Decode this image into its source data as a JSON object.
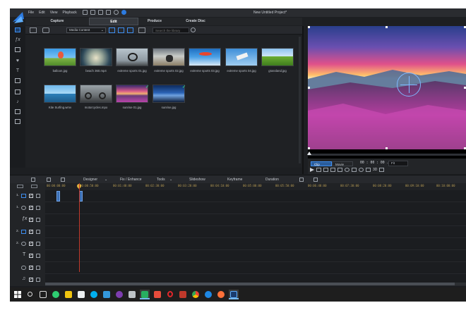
{
  "title_bar": {
    "menu": [
      "File",
      "Edit",
      "View",
      "Playback"
    ],
    "window_title": "New Untitled Project*"
  },
  "mode_tabs": [
    {
      "label": "Capture",
      "active": false
    },
    {
      "label": "Edit",
      "active": true
    },
    {
      "label": "Produce",
      "active": false
    },
    {
      "label": "Create Disc",
      "active": false
    }
  ],
  "library_toolbar": {
    "media_filter": "Media Content",
    "search_placeholder": "Search the library"
  },
  "media_items": [
    {
      "label": "balloon.jpg",
      "scene": "balloon"
    },
    {
      "label": "beach 360.mp4",
      "scene": "beach"
    },
    {
      "label": "extreme sports 01.jpg",
      "scene": "bike"
    },
    {
      "label": "extreme sports 02.jpg",
      "scene": "moto"
    },
    {
      "label": "extreme sports 03.jpg",
      "scene": "kite"
    },
    {
      "label": "extreme sports 04.jpg",
      "scene": "sky"
    },
    {
      "label": "grassland.jpg",
      "scene": "grass"
    },
    {
      "label": "Kite Surfing.wmv",
      "scene": "sea"
    },
    {
      "label": "motorcycles.mpo",
      "scene": "bikes"
    },
    {
      "label": "sunrise 01.jpg",
      "scene": "sunrise",
      "checked": true
    },
    {
      "label": "sunrise.jpg",
      "scene": "blue",
      "checked": true
    }
  ],
  "preview": {
    "clip_label": "Clip",
    "movie_label": "Movie",
    "timecode": "00 : 00 : 00 . 00",
    "fit": "Fit",
    "three_d": "3D"
  },
  "timeline_toolbar": {
    "buttons": [
      "Designer",
      "Fix / Enhance",
      "Tools",
      "Slideshow",
      "Keyframe",
      "Duration"
    ]
  },
  "ruler_ticks": [
    "00:00:00:00",
    "00:00:50:00",
    "00:01:40:00",
    "00:02:30:00",
    "00:03:20:00",
    "00:04:10:00",
    "00:05:00:00",
    "00:05:50:00",
    "00:06:40:00",
    "00:07:30:00",
    "00:08:20:00",
    "00:09:10:00",
    "00:10:00:00",
    "00:10:50:00",
    "00:11:40:00"
  ],
  "tracks": [
    {
      "num": "1.",
      "icon": "video",
      "lock": true
    },
    {
      "num": "1.",
      "icon": "audio",
      "lock": true
    },
    {
      "num": "",
      "icon": "fx",
      "lock": true
    },
    {
      "num": "2.",
      "icon": "video",
      "lock": true
    },
    {
      "num": "2.",
      "icon": "audio",
      "lock": true
    },
    {
      "num": "",
      "icon": "title",
      "lock": true
    },
    {
      "num": "",
      "icon": "voice",
      "lock": true
    },
    {
      "num": "",
      "icon": "music",
      "lock": true
    }
  ],
  "colors": {
    "accent": "#3e8ef0",
    "playhead": "#c0392b",
    "ruler_text": "#b59a54"
  },
  "taskbar": {
    "apps": [
      "start-icon",
      "search-icon",
      "task-view-icon",
      "chrome-like-icon",
      "explorer-icon",
      "store-icon",
      "skype-icon",
      "photos-icon",
      "viber-icon",
      "calendar-icon",
      "green-app-icon",
      "pdf-icon",
      "opera-icon",
      "acrobat-icon",
      "chrome-icon",
      "edge-icon",
      "firefox-icon",
      "powerdirector-icon"
    ]
  }
}
